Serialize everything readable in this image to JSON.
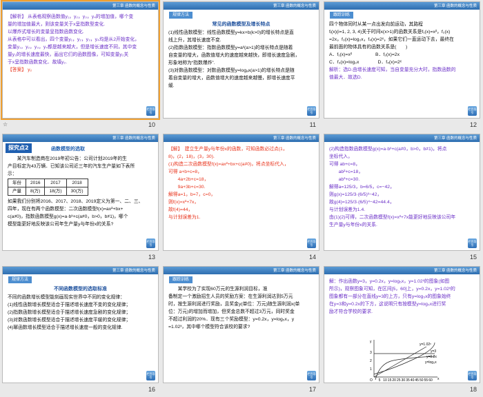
{
  "header": "第三章 函数的概念与性质",
  "back_label": "栏目导引",
  "slides": [
    {
      "number": "10",
      "lines": [
        {
          "t": "【解析】 从表格观察函数值y₁，y₂，y₃，y₄的增加值，哪个变",
          "c": "purple"
        },
        {
          "t": "量的增加值最大，则该变量关于x呈指数型变化.",
          "c": "purple"
        },
        {
          "t": "以爆炸式增长的变量呈指数函数变化.",
          "c": "purple"
        },
        {
          "t": "从表格中可以看出，四个变量y₁，y₂，y₃，y₄均是从2开始变化，",
          "c": "purple"
        },
        {
          "t": "变量y₁，y₂，y₃，y₄都是越来越大，但是增长速度不同，其中变",
          "c": "purple"
        },
        {
          "t": "量y₂的增长速度最快，画出它们的函数图像，可知变量y₂关",
          "c": "purple"
        },
        {
          "t": "于x呈指数函数变化．故填y₂.",
          "c": "purple"
        },
        {
          "t": "【答案】 y₂",
          "c": "red"
        }
      ]
    },
    {
      "number": "11",
      "tag": "规律方法",
      "title": "常见的函数模型及增长特点",
      "lines": [
        {
          "t": "(1)线性函数模型：线性函数模型y=kx+b(k>0)的增长特点是直",
          "c": ""
        },
        {
          "t": "线上升，其增长速度不变.",
          "c": ""
        },
        {
          "t": "(2)指数函数模型：指数函数模型y=aˣ(a>1)的增长特点是随着",
          "c": ""
        },
        {
          "t": "自变量的增大，函数值增大的速度越来越快，即增长速度急剧，",
          "c": ""
        },
        {
          "t": "形象地称为“指数爆炸”.",
          "c": ""
        },
        {
          "t": "(3)对数函数模型：对数函数模型y=logₐx(a>1)的增长特点是随",
          "c": ""
        },
        {
          "t": "着自变量的增大，函数值增大的速度越来越慢，即增长速度平",
          "c": ""
        },
        {
          "t": "缓.",
          "c": ""
        }
      ]
    },
    {
      "number": "12",
      "tag": "跟踪训练",
      "lines": [
        {
          "t": "四个物体同时从某一点出发向前运动，其路程",
          "c": ""
        },
        {
          "t": "fᵢ(x)(i=1, 2, 3, 4)关于时间x(x>1)的函数关系是f₁(x)=x²，f₂(x)",
          "c": ""
        },
        {
          "t": "=2x，f₃(x)=log₂x，f₄(x)=2ˣ，如果它们一直运动下去，最终在",
          "c": ""
        },
        {
          "t": "最前面的物体具有的函数关系是(　　)",
          "c": ""
        },
        {
          "t": "A．f₁(x)=x²　　　　　B．f₂(x)=2x",
          "c": ""
        },
        {
          "t": "C．f₃(x)=log₂x　　　　D．f₄(x)=2ˣ",
          "c": ""
        },
        {
          "t": "解析：选D.由增长速度可知，当自变量充分大时，指数函数的",
          "c": "purple"
        },
        {
          "t": "值最大．故选D.",
          "c": "purple"
        }
      ]
    },
    {
      "number": "13",
      "explore": "探究点2",
      "title": "函数模型的选取",
      "lines_before": [
        {
          "t": "　　某汽车制造商在2019年初公告：公司计划2019年的生",
          "c": ""
        },
        {
          "t": "产目标定为43万辆．已知该公司近三年的汽车生产量如下表所",
          "c": ""
        },
        {
          "t": "示：",
          "c": ""
        }
      ],
      "table": {
        "headers": [
          "年份",
          "2016",
          "2017",
          "2018"
        ],
        "row": [
          "产量",
          "8(万)",
          "18(万)",
          "30(万)"
        ]
      },
      "lines_after": [
        {
          "t": "如果我们分别将2016、2017、2018、2019定义为第一、二、三、",
          "c": ""
        },
        {
          "t": "四年，现在有两个函数模型：二次函数模型f(x)=ax²+bx+",
          "c": ""
        },
        {
          "t": "c(a≠0)，指数函数模型g(x)=a·bˣ+c(a≠0，b>0，b≠1)，哪个",
          "c": ""
        },
        {
          "t": "模型能更好地反映该公司年生产量y与年份x的关系?",
          "c": ""
        }
      ]
    },
    {
      "number": "14",
      "lines": [
        {
          "t": "【解】　建立生产量y与年份x的函数，可知函数必过点(1，",
          "c": "red"
        },
        {
          "t": "8)，(2，18)，(3，30).",
          "c": "red"
        },
        {
          "t": "(1)构造二次函数模型f(x)=ax²+bx+c(a≠0)，将点坐标代入，",
          "c": "red"
        },
        {
          "t": "可得 a+b+c=8，",
          "c": "red"
        },
        {
          "t": "　　4a+2b+c=18，",
          "c": "red"
        },
        {
          "t": "　　9a+3b+c=30.",
          "c": "red"
        },
        {
          "t": "解得a=1，b=7，c=0，",
          "c": "red"
        },
        {
          "t": "则f(x)=x²+7x，",
          "c": "red"
        },
        {
          "t": "故f(4)=44，",
          "c": "red"
        },
        {
          "t": "与计划误差为1.",
          "c": "red"
        }
      ]
    },
    {
      "number": "15",
      "lines": [
        {
          "t": "(2)构造指数函数模型g(x)=a·bˣ+c(a≠0，b>0，b≠1)，将点",
          "c": "purple"
        },
        {
          "t": "坐标代入，",
          "c": "purple"
        },
        {
          "t": "可得 ab+c=8，",
          "c": "purple"
        },
        {
          "t": "　　ab²+c=18，",
          "c": "purple"
        },
        {
          "t": "　　ab³+c=30.",
          "c": "purple"
        },
        {
          "t": "解得a=125/3，b=6/5，c=−42，",
          "c": "purple"
        },
        {
          "t": "则g(x)=125/3·(6/5)ˣ−42，",
          "c": "purple"
        },
        {
          "t": "故g(4)=125/3·(6/5)⁴−42=44.4，",
          "c": "purple"
        },
        {
          "t": "与计划误差为1.4.",
          "c": "purple"
        },
        {
          "t": "由(1)(2)可得，二次函数模型f(x)=x²+7x能更好地反映该公司年",
          "c": "purple"
        },
        {
          "t": "生产量y与年份x的关系.",
          "c": "purple"
        }
      ]
    },
    {
      "number": "16",
      "tag": "规律方法",
      "title": "不同函数模型的选取标准",
      "lines": [
        {
          "t": "不同的函数增长模型能刻画现实世界中不同的变化规律：",
          "c": ""
        },
        {
          "t": "(1)线性函数增长模型适合于描述增长速度不变的变化规律；",
          "c": ""
        },
        {
          "t": "(2)指数函数增长模型适合于描述增长速度急剧的变化规律；",
          "c": ""
        },
        {
          "t": "(3)对数函数增长模型适合于描述增长速度平缓的变化规律；",
          "c": ""
        },
        {
          "t": "(4)幂函数增长模型适合于描述增长速度一般的变化规律.",
          "c": ""
        }
      ]
    },
    {
      "number": "17",
      "tag": "跟踪训练",
      "lines": [
        {
          "t": "　　某学校为了实现60万元的生源利润目标，准",
          "c": ""
        },
        {
          "t": "备制定一个激励招生人员的奖励方案：在生源利润达到5万元",
          "c": ""
        },
        {
          "t": "时，按生源利润进行奖励，且奖金y(单位：万元)随生源利润x(单",
          "c": ""
        },
        {
          "t": "位：万元)的增加而增加，但奖金总数不超过3万元，同时奖金",
          "c": ""
        },
        {
          "t": "不超过利润的20%．现有三个奖励模型：y=0.2x，y=log₅x，y",
          "c": ""
        },
        {
          "t": "=1.02ˣ，其中哪个模型符合该校的要求?",
          "c": ""
        }
      ]
    },
    {
      "number": "18",
      "lines": [
        {
          "t": "解：作出函数y=3，y=0.2x，y=log₅x，y=1.02ˣ的图象(如图",
          "c": "purple"
        },
        {
          "t": "所示)，观察图象可知，在区间[5，60]上，y=0.2x，y=1.02ˣ的",
          "c": "purple"
        },
        {
          "t": "图象都有一部分在直线y=3的上方，只有y=log₅x的图象始终",
          "c": "purple"
        },
        {
          "t": "在y=3和y=0.2x的下方，这说明只有按模型y=log₅x进行奖",
          "c": "purple"
        },
        {
          "t": "励才符合学校的要求.",
          "c": "purple"
        }
      ],
      "graph": {
        "labels": [
          "y",
          "y=1.02ˣ",
          "y=3",
          "y=0.2x",
          "y=log₅x",
          "x",
          "O",
          "5",
          "10",
          "15",
          "20",
          "25",
          "30",
          "35",
          "40",
          "45",
          "50",
          "55",
          "60"
        ],
        "y_ticks": [
          "1",
          "2",
          "3"
        ]
      }
    }
  ],
  "selected_index": 0
}
